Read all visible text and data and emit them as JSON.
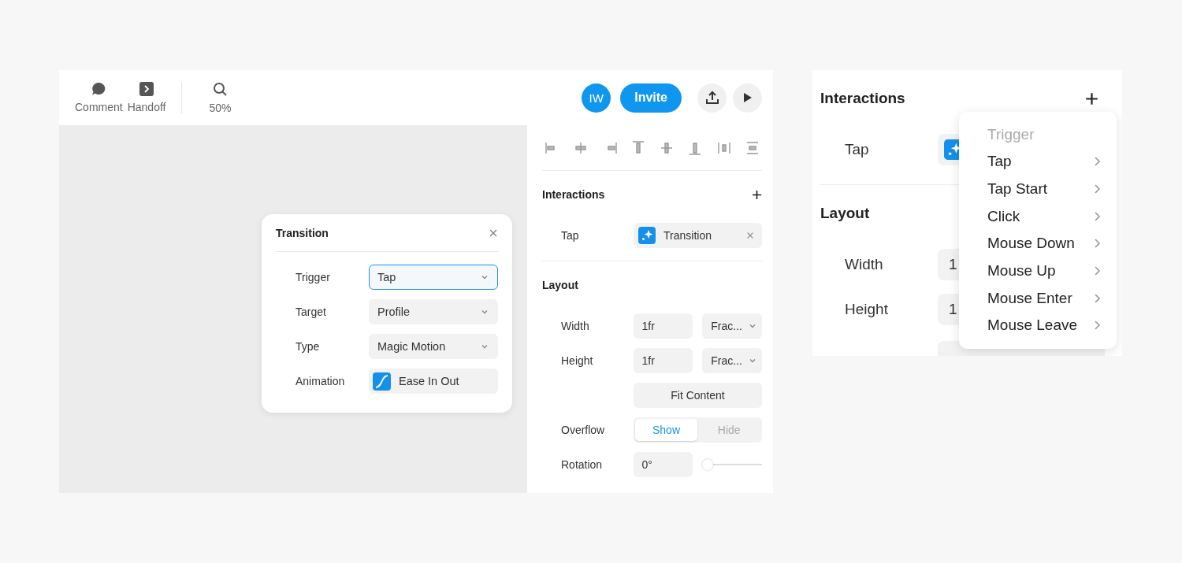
{
  "toolbar": {
    "tools": [
      {
        "label": "Comment",
        "kind": "comment"
      },
      {
        "label": "Handoff",
        "kind": "handoff"
      }
    ],
    "zoom": "50%",
    "avatar": "IW",
    "invite": "Invite"
  },
  "transition_popover": {
    "title": "Transition",
    "fields": [
      {
        "label": "Trigger",
        "value": "Tap",
        "kind": "select",
        "focused": true
      },
      {
        "label": "Target",
        "value": "Profile",
        "kind": "select",
        "focused": false
      },
      {
        "label": "Type",
        "value": "Magic Motion",
        "kind": "select",
        "focused": false
      },
      {
        "label": "Animation",
        "value": "Ease In Out",
        "kind": "curve"
      }
    ]
  },
  "properties": {
    "interactions": {
      "title": "Interactions",
      "items": [
        {
          "trigger": "Tap",
          "action": "Transition"
        }
      ]
    },
    "layout": {
      "title": "Layout",
      "rows": [
        {
          "kind": "size",
          "label": "Width",
          "value": "1fr",
          "unit": "Frac..."
        },
        {
          "kind": "size",
          "label": "Height",
          "value": "1fr",
          "unit": "Frac..."
        },
        {
          "kind": "button",
          "label": "Fit Content"
        },
        {
          "kind": "segmented",
          "label": "Overflow",
          "options": [
            {
              "label": "Show",
              "selected": true
            },
            {
              "label": "Hide",
              "selected": false
            }
          ]
        },
        {
          "kind": "slider",
          "label": "Rotation",
          "value": "0°",
          "level": 0
        }
      ]
    }
  },
  "zoomed_panel": {
    "interactions_title": "Interactions",
    "trigger": "Tap",
    "layout_title": "Layout",
    "rows": [
      {
        "label": "Width",
        "value": "1"
      },
      {
        "label": "Height",
        "value": "1"
      }
    ],
    "menu": {
      "title": "Trigger",
      "items": [
        "Tap",
        "Tap Start",
        "Click",
        "Mouse Down",
        "Mouse Up",
        "Mouse Enter",
        "Mouse Leave"
      ]
    }
  }
}
